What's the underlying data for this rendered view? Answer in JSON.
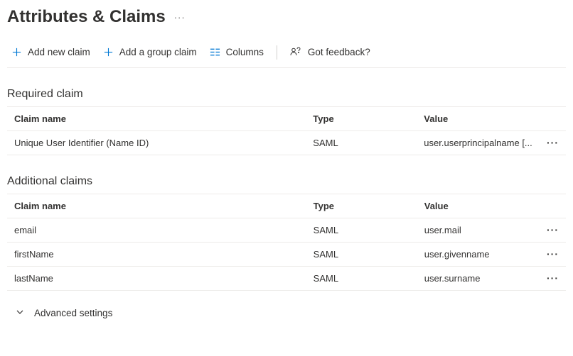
{
  "header": {
    "title": "Attributes & Claims"
  },
  "toolbar": {
    "add_claim": "Add new claim",
    "add_group_claim": "Add a group claim",
    "columns": "Columns",
    "feedback": "Got feedback?"
  },
  "sections": {
    "required": {
      "heading": "Required claim",
      "columns": {
        "name": "Claim name",
        "type": "Type",
        "value": "Value"
      },
      "rows": [
        {
          "name": "Unique User Identifier (Name ID)",
          "type": "SAML",
          "value": "user.userprincipalname [..."
        }
      ]
    },
    "additional": {
      "heading": "Additional claims",
      "columns": {
        "name": "Claim name",
        "type": "Type",
        "value": "Value"
      },
      "rows": [
        {
          "name": "email",
          "type": "SAML",
          "value": "user.mail"
        },
        {
          "name": "firstName",
          "type": "SAML",
          "value": "user.givenname"
        },
        {
          "name": "lastName",
          "type": "SAML",
          "value": "user.surname"
        }
      ]
    }
  },
  "advanced": {
    "label": "Advanced settings"
  },
  "colors": {
    "accent": "#0078d4"
  }
}
